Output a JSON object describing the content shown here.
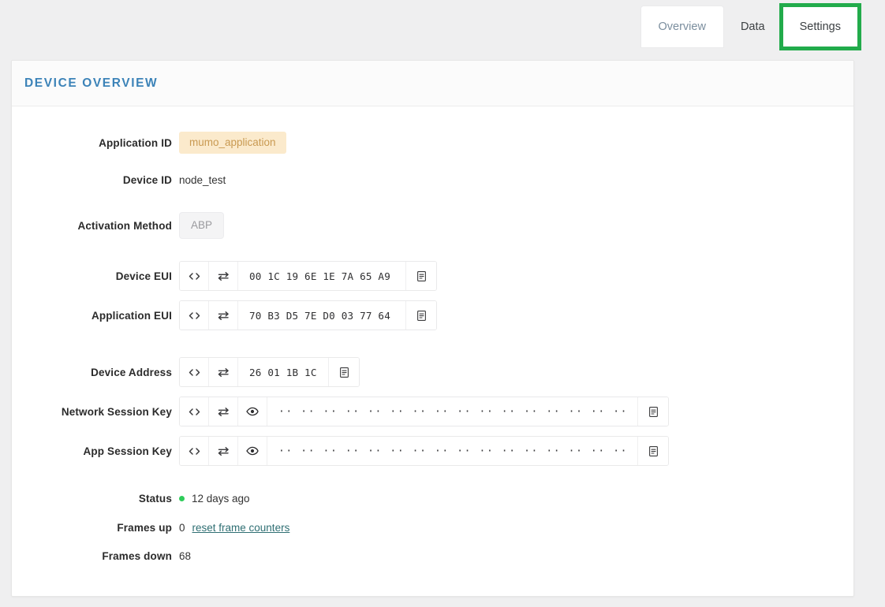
{
  "tabs": [
    {
      "label": "Overview",
      "state": "active"
    },
    {
      "label": "Data",
      "state": "normal"
    },
    {
      "label": "Settings",
      "state": "highlighted"
    }
  ],
  "highlight_color": "#22ab4b",
  "card": {
    "title": "Device Overview",
    "fields": {
      "application_id": {
        "label": "Application ID",
        "value": "mumo_application"
      },
      "device_id": {
        "label": "Device ID",
        "value": "node_test"
      },
      "activation_method": {
        "label": "Activation Method",
        "value": "ABP"
      },
      "device_eui": {
        "label": "Device EUI",
        "value": "00 1C 19 6E 1E 7A 65 A9"
      },
      "application_eui": {
        "label": "Application EUI",
        "value": "70 B3 D5 7E D0 03 77 64"
      },
      "device_address": {
        "label": "Device Address",
        "value": "26 01 1B 1C"
      },
      "network_session_key": {
        "label": "Network Session Key",
        "value": "·· ·· ·· ·· ·· ·· ·· ·· ·· ·· ·· ·· ·· ·· ·· ··"
      },
      "app_session_key": {
        "label": "App Session Key",
        "value": "·· ·· ·· ·· ·· ·· ·· ·· ·· ·· ·· ·· ·· ·· ·· ··"
      },
      "status": {
        "label": "Status",
        "value": "12 days ago",
        "indicator_color": "#2ecc5a"
      },
      "frames_up": {
        "label": "Frames up",
        "value": "0",
        "link": "reset frame counters"
      },
      "frames_down": {
        "label": "Frames down",
        "value": "68"
      }
    },
    "icons": {
      "code": "code-brackets-icon",
      "swap": "swap-arrows-icon",
      "eye": "eye-icon",
      "copy": "clipboard-copy-icon"
    }
  }
}
